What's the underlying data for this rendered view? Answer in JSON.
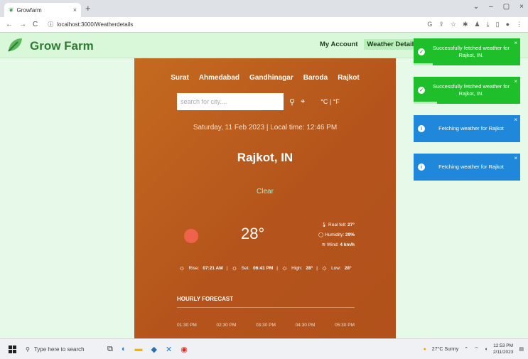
{
  "browser": {
    "tab_title": "Growfarm",
    "url": "localhost:3000/Weatherdetails"
  },
  "header": {
    "brand": "Grow Farm",
    "nav": [
      "My Account",
      "Weather Details"
    ]
  },
  "weather": {
    "cities": [
      "Surat",
      "Ahmedabad",
      "Gandhinagar",
      "Baroda",
      "Rajkot"
    ],
    "search_placeholder": "search for city....",
    "units": "°C | °F",
    "datetime": "Saturday, 11 Feb 2023 | Local time: 12:46 PM",
    "city": "Rajkot, IN",
    "condition": "Clear",
    "temperature": "28°",
    "real_feel_label": "Real fell:",
    "real_feel": "27°",
    "humidity_label": "Humidity:",
    "humidity": "29%",
    "wind_label": "Wind:",
    "wind": "4 km/h",
    "rise_label": "Rise:",
    "rise": "07:21 AM",
    "set_label": "Set:",
    "set": "06:41 PM",
    "high_label": "High:",
    "high": "28°",
    "low_label": "Low:",
    "low": "28°",
    "hourly_title": "HOURLY FORECAST",
    "hours": [
      "01:30 PM",
      "02:30 PM",
      "03:30 PM",
      "04:30 PM",
      "05:30 PM"
    ]
  },
  "toasts": [
    {
      "type": "success",
      "message": "Successfully fetched weather for Rajkot, IN."
    },
    {
      "type": "success",
      "message": "Successfully fetched weather for Rajkot, IN."
    },
    {
      "type": "info",
      "message": "Fetching weather for Rajkot"
    },
    {
      "type": "info",
      "message": "Fetching weather for Rajkot"
    }
  ],
  "taskbar": {
    "search_placeholder": "Type here to search",
    "weather": "27°C Sunny",
    "time": "12:53 PM",
    "date": "2/11/2023"
  },
  "colors": {
    "brand_green": "#2e7d32",
    "card_orange": "#b8581c",
    "success": "#1fbe2b",
    "info": "#1f88da"
  }
}
